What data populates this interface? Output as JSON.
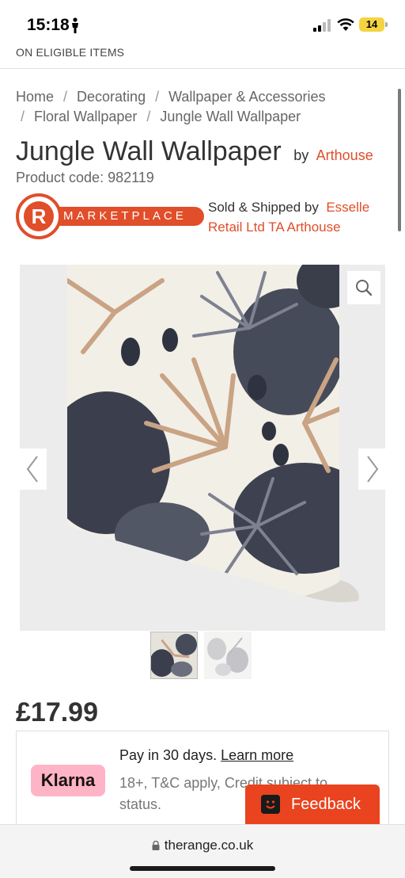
{
  "status_bar": {
    "time": "15:18",
    "battery": "14"
  },
  "promo": {
    "text": "ON ELIGIBLE ITEMS"
  },
  "breadcrumb": {
    "items": [
      "Home",
      "Decorating",
      "Wallpaper & Accessories",
      "Floral Wallpaper",
      "Jungle Wall Wallpaper"
    ],
    "separator": "/"
  },
  "product": {
    "title": "Jungle Wall Wallpaper",
    "by_label": "by",
    "brand": "Arthouse",
    "code_label": "Product code:",
    "code": "982119",
    "price": "£17.99"
  },
  "marketplace": {
    "logo_letter": "R",
    "logo_text": "MARKETPLACE",
    "sold_label": "Sold & Shipped by",
    "seller": "Esselle Retail Ltd TA Arthouse"
  },
  "klarna": {
    "badge": "Klarna",
    "line1": "Pay in 30 days.",
    "learn_more": "Learn more",
    "line2": "18+, T&C apply, Credit subject to status."
  },
  "feedback": {
    "label": "Feedback"
  },
  "browser": {
    "url": "therange.co.uk"
  },
  "colors": {
    "accent": "#e04e2a",
    "klarna_pink": "#ffb3c7",
    "feedback": "#e9441f"
  },
  "icons": [
    "person-icon",
    "signal-icon",
    "wifi-icon",
    "search-icon",
    "chevron-left-icon",
    "chevron-right-icon",
    "feedback-icon",
    "lock-icon"
  ]
}
